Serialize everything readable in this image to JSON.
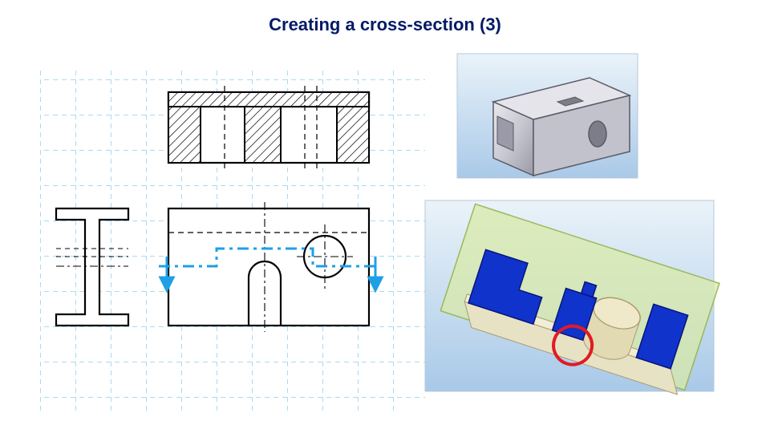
{
  "title": "Creating a cross-section (3)",
  "colors": {
    "title": "#001a66",
    "grid": "#56b6e6",
    "cut_arrow": "#1ea0e6",
    "hatch": "#000000",
    "part_body": "#cfcfd6",
    "part_edge": "#5a5a66",
    "viewer_bg_top": "#eaf3f9",
    "viewer_bg_bottom": "#a9c9e8",
    "section_solid": "#1033cc",
    "section_plane": "#d8e9a8",
    "highlight_ring": "#e01b24"
  },
  "figures": {
    "grid": {
      "cols": 11,
      "rows": 10,
      "cell": 44
    },
    "top_section_view": "Top: sectional front view with hatching showing stepped slot and through-hole",
    "left_side_view": "Left: side profile outline of block",
    "front_view": "Center: front elevation with stepped cutting-plane line and arrows",
    "iso_render": "Upper-right: 3D shaded model, grey block with slot and hole",
    "section_render": "Lower-right: 3D section preview, blue solid on green cutting plane, red circle highlight"
  }
}
